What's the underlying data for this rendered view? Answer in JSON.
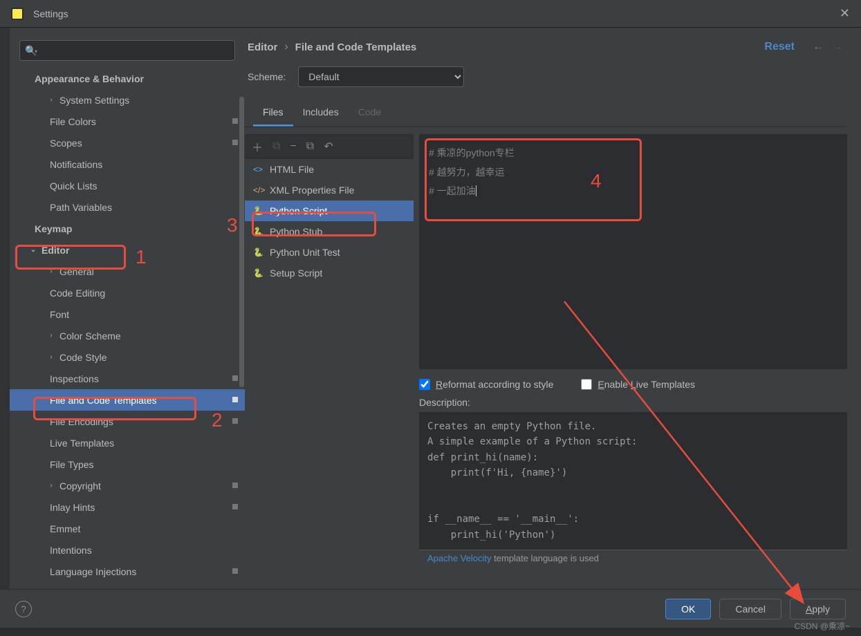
{
  "title": "Settings",
  "breadcrumb": {
    "a": "Editor",
    "b": "File and Code Templates"
  },
  "reset": "Reset",
  "scheme_label": "Scheme:",
  "scheme_value": "Default",
  "tabs": {
    "files": "Files",
    "includes": "Includes",
    "code": "Code"
  },
  "sidebar": {
    "appearance": "Appearance & Behavior",
    "system_settings": "System Settings",
    "file_colors": "File Colors",
    "scopes": "Scopes",
    "notifications": "Notifications",
    "quick_lists": "Quick Lists",
    "path_variables": "Path Variables",
    "keymap": "Keymap",
    "editor": "Editor",
    "general": "General",
    "code_editing": "Code Editing",
    "font": "Font",
    "color_scheme": "Color Scheme",
    "code_style": "Code Style",
    "inspections": "Inspections",
    "file_templates": "File and Code Templates",
    "file_encodings": "File Encodings",
    "live_templates": "Live Templates",
    "file_types": "File Types",
    "copyright": "Copyright",
    "inlay_hints": "Inlay Hints",
    "emmet": "Emmet",
    "intentions": "Intentions",
    "language_injections": "Language Injections"
  },
  "files": {
    "html": "HTML File",
    "xml": "XML Properties File",
    "pyscript": "Python Script",
    "pystub": "Python Stub",
    "pyunit": "Python Unit Test",
    "setup": "Setup Script"
  },
  "editor_text": "# 乘凉的python专栏\n# 越努力，越幸运\n# 一起加油",
  "reformat": "Reformat according to style",
  "enable_live": "Enable Live Templates",
  "desc_label": "Description:",
  "description": "Creates an empty Python file.\nA simple example of a Python script:\ndef print_hi(name):\n    print(f'Hi, {name}')\n\n\nif __name__ == '__main__':\n    print_hi('Python')",
  "velocity_link": "Apache Velocity",
  "velocity_rest": " template language is used",
  "buttons": {
    "ok": "OK",
    "cancel": "Cancel",
    "apply": "Apply"
  },
  "annotations": {
    "n1": "1",
    "n2": "2",
    "n3": "3",
    "n4": "4"
  },
  "watermark": "CSDN @乘凉~"
}
